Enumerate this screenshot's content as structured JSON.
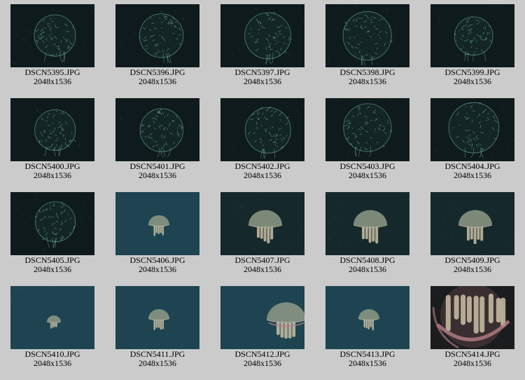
{
  "thumbnails": [
    {
      "filename": "DSCN5395.JPG",
      "dimensions": "2048x1536",
      "subject": "medusa-mesh-dark"
    },
    {
      "filename": "DSCN5396.JPG",
      "dimensions": "2048x1536",
      "subject": "medusa-mesh-dark"
    },
    {
      "filename": "DSCN5397.JPG",
      "dimensions": "2048x1536",
      "subject": "medusa-mesh-dark"
    },
    {
      "filename": "DSCN5398.JPG",
      "dimensions": "2048x1536",
      "subject": "medusa-mesh-dark"
    },
    {
      "filename": "DSCN5399.JPG",
      "dimensions": "2048x1536",
      "subject": "medusa-mesh-dark"
    },
    {
      "filename": "DSCN5400.JPG",
      "dimensions": "2048x1536",
      "subject": "medusa-mesh-dark"
    },
    {
      "filename": "DSCN5401.JPG",
      "dimensions": "2048x1536",
      "subject": "medusa-mesh-dark"
    },
    {
      "filename": "DSCN5402.JPG",
      "dimensions": "2048x1536",
      "subject": "medusa-mesh-dark"
    },
    {
      "filename": "DSCN5403.JPG",
      "dimensions": "2048x1536",
      "subject": "medusa-mesh-dark"
    },
    {
      "filename": "DSCN5404.JPG",
      "dimensions": "2048x1536",
      "subject": "medusa-mesh-dark"
    },
    {
      "filename": "DSCN5405.JPG",
      "dimensions": "2048x1536",
      "subject": "medusa-mesh-dark"
    },
    {
      "filename": "DSCN5406.JPG",
      "dimensions": "2048x1536",
      "subject": "jellyfish-small"
    },
    {
      "filename": "DSCN5407.JPG",
      "dimensions": "2048x1536",
      "subject": "jellyfish-medium"
    },
    {
      "filename": "DSCN5408.JPG",
      "dimensions": "2048x1536",
      "subject": "jellyfish-medium"
    },
    {
      "filename": "DSCN5409.JPG",
      "dimensions": "2048x1536",
      "subject": "jellyfish-medium"
    },
    {
      "filename": "DSCN5410.JPG",
      "dimensions": "2048x1536",
      "subject": "jellyfish-tiny"
    },
    {
      "filename": "DSCN5411.JPG",
      "dimensions": "2048x1536",
      "subject": "jellyfish-small"
    },
    {
      "filename": "DSCN5412.JPG",
      "dimensions": "2048x1536",
      "subject": "jellyfish-large"
    },
    {
      "filename": "DSCN5413.JPG",
      "dimensions": "2048x1536",
      "subject": "jellyfish-small"
    },
    {
      "filename": "DSCN5414.JPG",
      "dimensions": "2048x1536",
      "subject": "jellyfish-closeup"
    }
  ],
  "colors": {
    "page_background": "#cbcbcb",
    "dark_water": "#0f1a1c",
    "blue_water": "#1d4450",
    "mesh_line": "#7fc9b0",
    "bell": "#8f9a86",
    "tentacle": "#cbbfa6",
    "closeup_pink": "#b87e86"
  }
}
